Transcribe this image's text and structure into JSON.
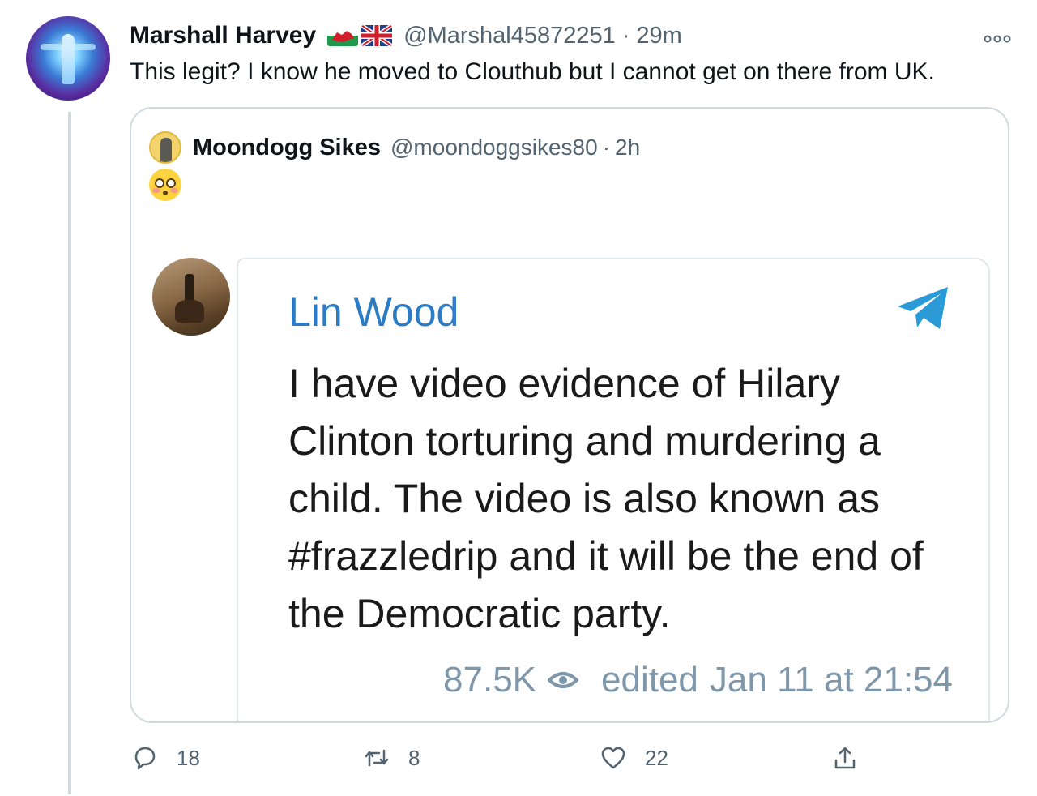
{
  "tweet": {
    "display_name": "Marshall Harvey",
    "handle": "@Marshal45872251",
    "separator": "·",
    "time": "29m",
    "text": "This legit? I know he moved to Clouthub but I cannot get on there from UK.",
    "flag_icons": [
      "wales-flag-icon",
      "uk-flag-icon"
    ]
  },
  "quoted_tweet": {
    "display_name": "Moondogg Sikes",
    "handle": "@moondoggsikes80",
    "separator": "·",
    "time": "2h",
    "emoji": "flushed-face-emoji"
  },
  "telegram_post": {
    "channel_name": "Lin Wood",
    "text": "I have video evidence of Hilary Clinton torturing and murdering a child. The video is also known as #frazzledrip and it will be the end of the Democratic party.",
    "views": "87.5K",
    "edited_label": "edited",
    "timestamp": "Jan 11 at 21:54",
    "accent_color": "#2b7cc6"
  },
  "actions": {
    "reply_count": "18",
    "retweet_count": "8",
    "like_count": "22"
  },
  "colors": {
    "secondary_text": "#536471",
    "border": "#cfd9de"
  }
}
